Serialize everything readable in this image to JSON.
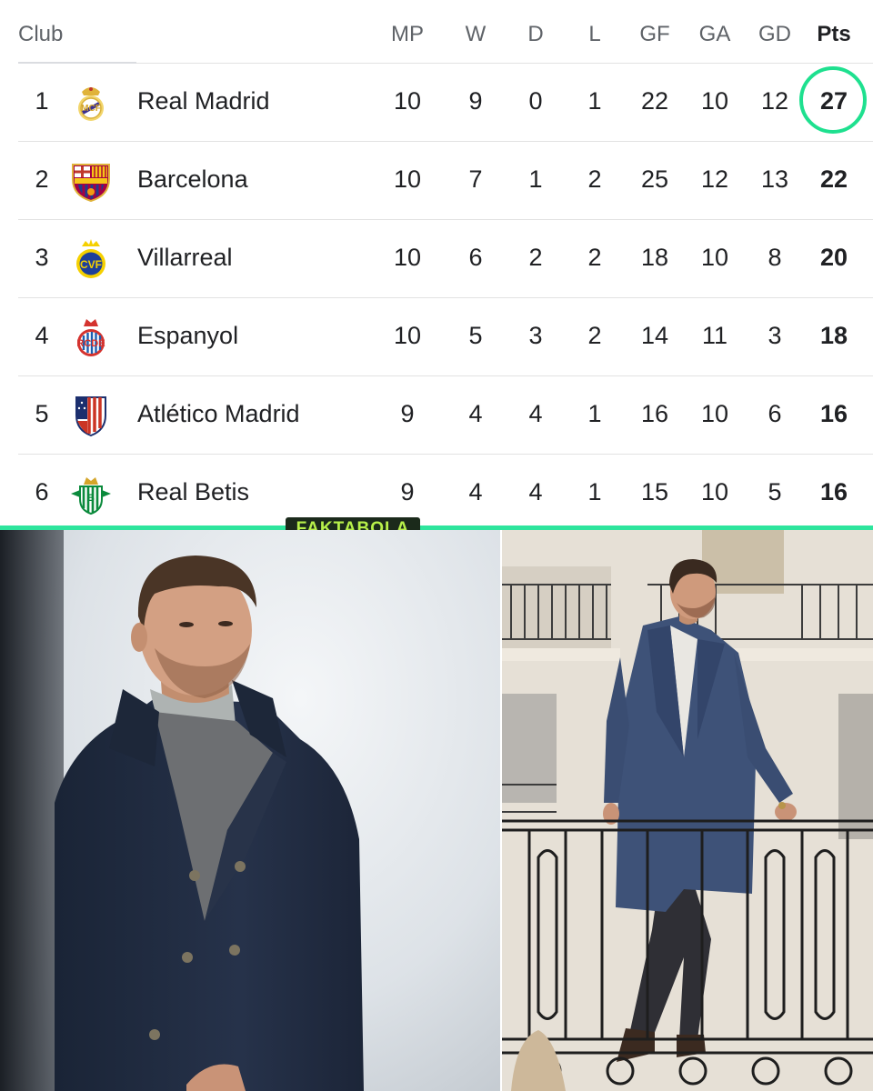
{
  "columns": {
    "club": "Club",
    "mp": "MP",
    "w": "W",
    "d": "D",
    "l": "L",
    "gf": "GF",
    "ga": "GA",
    "gd": "GD",
    "pts": "Pts"
  },
  "rows": [
    {
      "pos": "1",
      "name": "Real Madrid",
      "mp": "10",
      "w": "9",
      "d": "0",
      "l": "1",
      "gf": "22",
      "ga": "10",
      "gd": "12",
      "pts": "27",
      "crest": "real-madrid-crest-icon"
    },
    {
      "pos": "2",
      "name": "Barcelona",
      "mp": "10",
      "w": "7",
      "d": "1",
      "l": "2",
      "gf": "25",
      "ga": "12",
      "gd": "13",
      "pts": "22",
      "crest": "barcelona-crest-icon"
    },
    {
      "pos": "3",
      "name": "Villarreal",
      "mp": "10",
      "w": "6",
      "d": "2",
      "l": "2",
      "gf": "18",
      "ga": "10",
      "gd": "8",
      "pts": "20",
      "crest": "villarreal-crest-icon"
    },
    {
      "pos": "4",
      "name": "Espanyol",
      "mp": "10",
      "w": "5",
      "d": "3",
      "l": "2",
      "gf": "14",
      "ga": "11",
      "gd": "3",
      "pts": "18",
      "crest": "espanyol-crest-icon"
    },
    {
      "pos": "5",
      "name": "Atlético Madrid",
      "mp": "9",
      "w": "4",
      "d": "4",
      "l": "1",
      "gf": "16",
      "ga": "10",
      "gd": "6",
      "pts": "16",
      "crest": "atletico-madrid-crest-icon"
    },
    {
      "pos": "6",
      "name": "Real Betis",
      "mp": "9",
      "w": "4",
      "d": "4",
      "l": "1",
      "gf": "15",
      "ga": "10",
      "gd": "5",
      "pts": "16",
      "crest": "real-betis-crest-icon"
    }
  ],
  "highlight_color": "#1ee08f",
  "logo": {
    "text": "FAKTABOLA"
  }
}
